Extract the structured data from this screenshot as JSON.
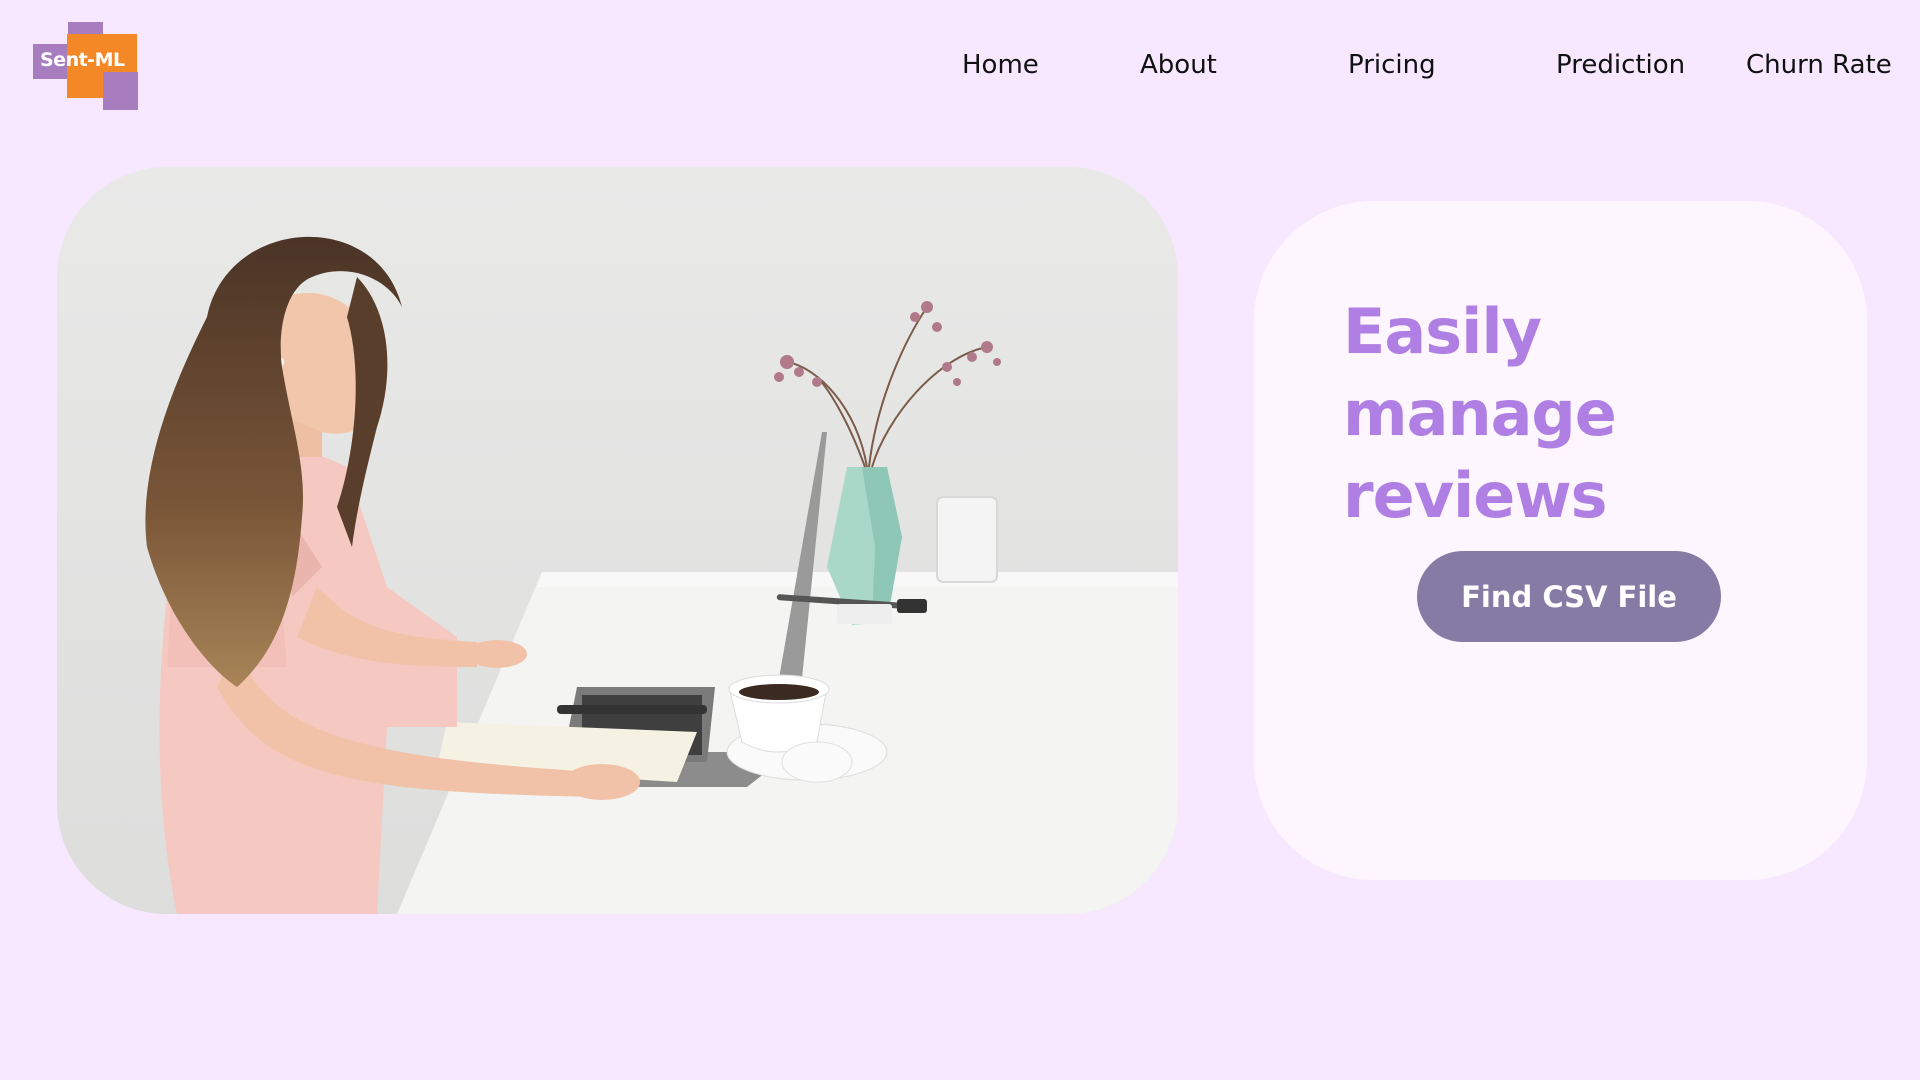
{
  "brand": {
    "logo_text": "Sent-ML",
    "colors": {
      "primary": "#a87dbf",
      "accent": "#f48726"
    }
  },
  "nav": {
    "items": [
      {
        "label": "Home"
      },
      {
        "label": "About"
      },
      {
        "label": "Pricing"
      },
      {
        "label": "Prediction"
      },
      {
        "label": "Churn Rate"
      }
    ]
  },
  "hero": {
    "image": "photo-woman-typing-on-laptop-at-white-desk"
  },
  "card": {
    "headline": "Easily manage reviews",
    "button_label": "Find CSV File",
    "colors": {
      "headline": "#b07fe3",
      "button": "#857ba5",
      "background": "#fdf6ff"
    }
  },
  "theme": {
    "page_background": "#f7e8ff"
  }
}
